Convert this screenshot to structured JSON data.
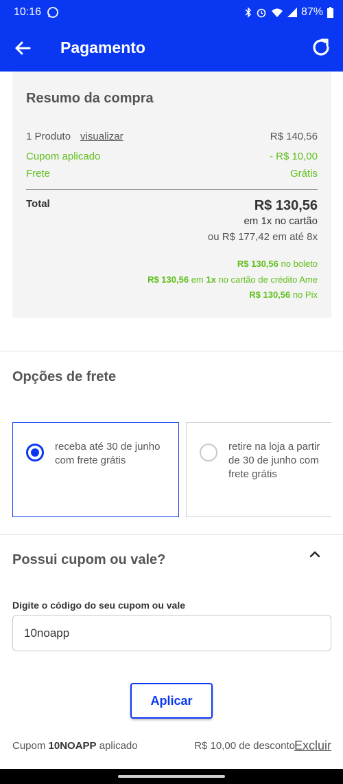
{
  "status_bar": {
    "time": "10:16",
    "battery": "87%",
    "icons": [
      "whatsapp-icon",
      "bluetooth-icon",
      "alarm-icon",
      "wifi-icon",
      "signal-icon",
      "battery-icon"
    ]
  },
  "app_bar": {
    "title": "Pagamento",
    "back_icon": "arrow-left-icon",
    "refresh_icon": "refresh-icon"
  },
  "colors": {
    "brand_blue": "#0a38f2",
    "success_green": "#5fbf1c",
    "card_gray": "#f4f4f4"
  },
  "summary": {
    "title": "Resumo da compra",
    "products_label": "1 Produto",
    "view_link": "visualizar",
    "products_value": "R$ 140,56",
    "coupon_label": "Cupom aplicado",
    "coupon_value": "- R$ 10,00",
    "shipping_label": "Frete",
    "shipping_value": "Grátis",
    "total_label": "Total",
    "total_value": "R$ 130,56",
    "total_sub": "em 1x no cartão",
    "installments": "ou R$ 177,42 em até 8x",
    "boleto_value": "R$ 130,56",
    "boleto_text": " no boleto",
    "ame_value": "R$ 130,56",
    "ame_mid": " em ",
    "ame_times": "1x",
    "ame_text": " no cartão de crédito Ame",
    "pix_value": "R$ 130,56",
    "pix_text": " no Pix"
  },
  "shipping": {
    "title": "Opções de frete",
    "options": [
      {
        "text": "receba até 30 de junho com frete grátis",
        "selected": true
      },
      {
        "text": "retire na loja a partir de 30 de junho com frete grátis",
        "selected": false
      }
    ]
  },
  "coupon": {
    "title": "Possui cupom ou vale?",
    "field_label": "Digite o código do seu cupom ou vale",
    "input_value": "10noapp",
    "apply_label": "Aplicar",
    "applied_prefix": "Cupom ",
    "applied_code": "10NOAPP",
    "applied_suffix": " aplicado",
    "discount_text": "R$ 10,00 de desconto",
    "remove_label": "Excluir"
  }
}
